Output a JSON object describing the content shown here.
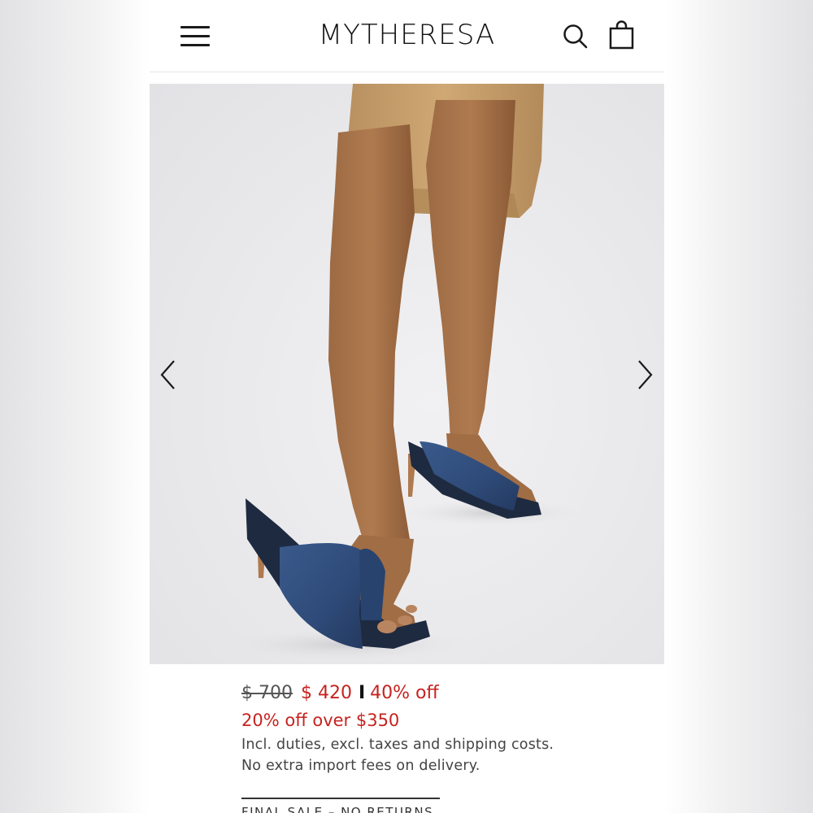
{
  "header": {
    "brand": "MYTHERESA",
    "icons": [
      "hamburger-menu-icon",
      "search-icon",
      "shopping-bag-icon"
    ]
  },
  "gallery": {
    "icons": [
      "chevron-left-icon",
      "chevron-right-icon"
    ]
  },
  "product": {
    "price_original": "$ 700",
    "price_sale": "$ 420",
    "separator": "I",
    "discount": "40% off",
    "promo": "20% off over $350",
    "duties_note": "Incl. duties, excl. taxes and shipping costs.",
    "import_note": "No extra import fees on delivery.",
    "final_sale": "FINAL SALE – NO RETURNS"
  },
  "colors": {
    "sale_red": "#c7231f",
    "text_dark": "#111111",
    "denim": "#2e4a78",
    "skirt": "#c9a46f"
  }
}
